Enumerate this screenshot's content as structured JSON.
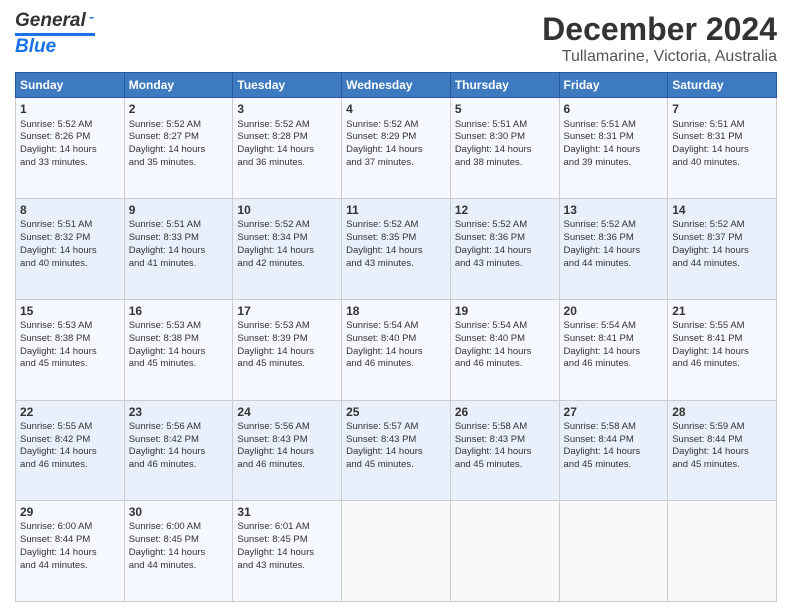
{
  "header": {
    "logo_line1": "General",
    "logo_line2": "Blue",
    "main_title": "December 2024",
    "subtitle": "Tullamarine, Victoria, Australia"
  },
  "calendar": {
    "days_of_week": [
      "Sunday",
      "Monday",
      "Tuesday",
      "Wednesday",
      "Thursday",
      "Friday",
      "Saturday"
    ],
    "weeks": [
      [
        {
          "day": "",
          "content": ""
        },
        {
          "day": "2",
          "content": "Sunrise: 5:52 AM\nSunset: 8:27 PM\nDaylight: 14 hours\nand 35 minutes."
        },
        {
          "day": "3",
          "content": "Sunrise: 5:52 AM\nSunset: 8:28 PM\nDaylight: 14 hours\nand 36 minutes."
        },
        {
          "day": "4",
          "content": "Sunrise: 5:52 AM\nSunset: 8:29 PM\nDaylight: 14 hours\nand 37 minutes."
        },
        {
          "day": "5",
          "content": "Sunrise: 5:51 AM\nSunset: 8:30 PM\nDaylight: 14 hours\nand 38 minutes."
        },
        {
          "day": "6",
          "content": "Sunrise: 5:51 AM\nSunset: 8:31 PM\nDaylight: 14 hours\nand 39 minutes."
        },
        {
          "day": "7",
          "content": "Sunrise: 5:51 AM\nSunset: 8:31 PM\nDaylight: 14 hours\nand 40 minutes."
        }
      ],
      [
        {
          "day": "8",
          "content": "Sunrise: 5:51 AM\nSunset: 8:32 PM\nDaylight: 14 hours\nand 40 minutes."
        },
        {
          "day": "9",
          "content": "Sunrise: 5:51 AM\nSunset: 8:33 PM\nDaylight: 14 hours\nand 41 minutes."
        },
        {
          "day": "10",
          "content": "Sunrise: 5:52 AM\nSunset: 8:34 PM\nDaylight: 14 hours\nand 42 minutes."
        },
        {
          "day": "11",
          "content": "Sunrise: 5:52 AM\nSunset: 8:35 PM\nDaylight: 14 hours\nand 43 minutes."
        },
        {
          "day": "12",
          "content": "Sunrise: 5:52 AM\nSunset: 8:36 PM\nDaylight: 14 hours\nand 43 minutes."
        },
        {
          "day": "13",
          "content": "Sunrise: 5:52 AM\nSunset: 8:36 PM\nDaylight: 14 hours\nand 44 minutes."
        },
        {
          "day": "14",
          "content": "Sunrise: 5:52 AM\nSunset: 8:37 PM\nDaylight: 14 hours\nand 44 minutes."
        }
      ],
      [
        {
          "day": "15",
          "content": "Sunrise: 5:53 AM\nSunset: 8:38 PM\nDaylight: 14 hours\nand 45 minutes."
        },
        {
          "day": "16",
          "content": "Sunrise: 5:53 AM\nSunset: 8:38 PM\nDaylight: 14 hours\nand 45 minutes."
        },
        {
          "day": "17",
          "content": "Sunrise: 5:53 AM\nSunset: 8:39 PM\nDaylight: 14 hours\nand 45 minutes."
        },
        {
          "day": "18",
          "content": "Sunrise: 5:54 AM\nSunset: 8:40 PM\nDaylight: 14 hours\nand 46 minutes."
        },
        {
          "day": "19",
          "content": "Sunrise: 5:54 AM\nSunset: 8:40 PM\nDaylight: 14 hours\nand 46 minutes."
        },
        {
          "day": "20",
          "content": "Sunrise: 5:54 AM\nSunset: 8:41 PM\nDaylight: 14 hours\nand 46 minutes."
        },
        {
          "day": "21",
          "content": "Sunrise: 5:55 AM\nSunset: 8:41 PM\nDaylight: 14 hours\nand 46 minutes."
        }
      ],
      [
        {
          "day": "22",
          "content": "Sunrise: 5:55 AM\nSunset: 8:42 PM\nDaylight: 14 hours\nand 46 minutes."
        },
        {
          "day": "23",
          "content": "Sunrise: 5:56 AM\nSunset: 8:42 PM\nDaylight: 14 hours\nand 46 minutes."
        },
        {
          "day": "24",
          "content": "Sunrise: 5:56 AM\nSunset: 8:43 PM\nDaylight: 14 hours\nand 46 minutes."
        },
        {
          "day": "25",
          "content": "Sunrise: 5:57 AM\nSunset: 8:43 PM\nDaylight: 14 hours\nand 45 minutes."
        },
        {
          "day": "26",
          "content": "Sunrise: 5:58 AM\nSunset: 8:43 PM\nDaylight: 14 hours\nand 45 minutes."
        },
        {
          "day": "27",
          "content": "Sunrise: 5:58 AM\nSunset: 8:44 PM\nDaylight: 14 hours\nand 45 minutes."
        },
        {
          "day": "28",
          "content": "Sunrise: 5:59 AM\nSunset: 8:44 PM\nDaylight: 14 hours\nand 45 minutes."
        }
      ],
      [
        {
          "day": "29",
          "content": "Sunrise: 6:00 AM\nSunset: 8:44 PM\nDaylight: 14 hours\nand 44 minutes."
        },
        {
          "day": "30",
          "content": "Sunrise: 6:00 AM\nSunset: 8:45 PM\nDaylight: 14 hours\nand 44 minutes."
        },
        {
          "day": "31",
          "content": "Sunrise: 6:01 AM\nSunset: 8:45 PM\nDaylight: 14 hours\nand 43 minutes."
        },
        {
          "day": "",
          "content": ""
        },
        {
          "day": "",
          "content": ""
        },
        {
          "day": "",
          "content": ""
        },
        {
          "day": "",
          "content": ""
        }
      ]
    ],
    "week1_day1": {
      "day": "1",
      "content": "Sunrise: 5:52 AM\nSunset: 8:26 PM\nDaylight: 14 hours\nand 33 minutes."
    }
  }
}
